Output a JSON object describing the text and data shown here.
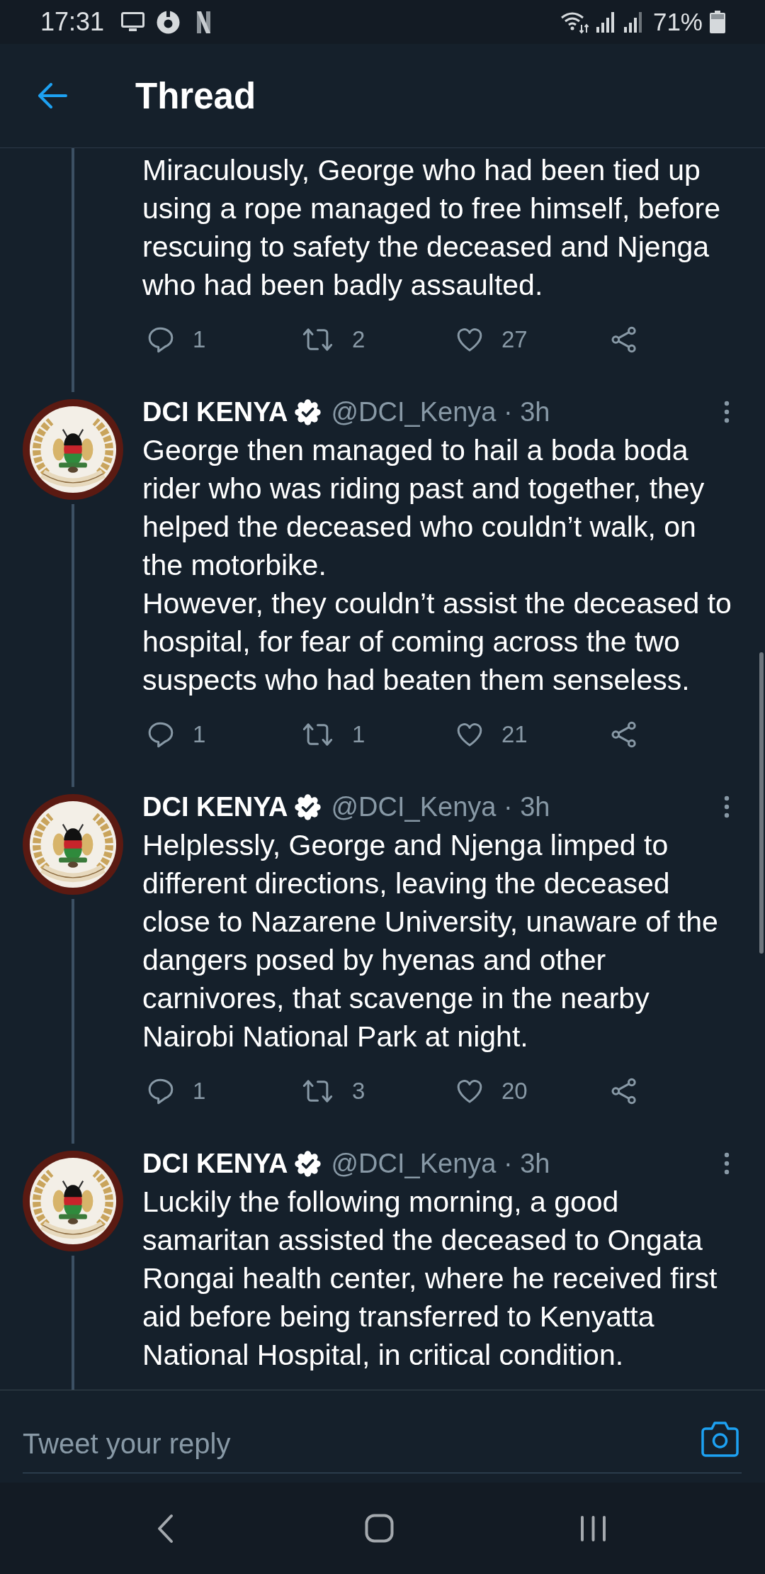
{
  "status_bar": {
    "time": "17:31",
    "battery": "71%"
  },
  "header": {
    "title": "Thread"
  },
  "tweets": [
    {
      "paragraphs": [
        "Miraculously, George who had been tied up using a rope managed to free himself, before rescuing to safety the deceased and Njenga who had been badly assaulted."
      ],
      "actions": [
        {
          "kind": "reply",
          "count": "1"
        },
        {
          "kind": "retweet",
          "count": "2"
        },
        {
          "kind": "like",
          "count": "27"
        },
        {
          "kind": "share"
        }
      ]
    },
    {
      "author": {
        "name": "DCI KENYA",
        "verified": true,
        "byline": "@DCI_Kenya · 3h"
      },
      "paragraphs": [
        "George then managed to hail a boda boda rider who was riding past and together, they helped the deceased who couldn’t walk, on the motorbike.",
        "However, they couldn’t assist the deceased to hospital, for fear of coming across the two suspects who had beaten them senseless."
      ],
      "actions": [
        {
          "kind": "reply",
          "count": "1"
        },
        {
          "kind": "retweet",
          "count": "1"
        },
        {
          "kind": "like",
          "count": "21"
        },
        {
          "kind": "share"
        }
      ]
    },
    {
      "author": {
        "name": "DCI KENYA",
        "verified": true,
        "byline": "@DCI_Kenya · 3h"
      },
      "paragraphs": [
        "Helplessly, George and Njenga limped to different directions, leaving the deceased close to Nazarene University, unaware of the dangers posed by hyenas and other carnivores, that scavenge in the nearby Nairobi National Park at night."
      ],
      "actions": [
        {
          "kind": "reply",
          "count": "1"
        },
        {
          "kind": "retweet",
          "count": "3"
        },
        {
          "kind": "like",
          "count": "20"
        },
        {
          "kind": "share"
        }
      ]
    },
    {
      "author": {
        "name": "DCI KENYA",
        "verified": true,
        "byline": "@DCI_Kenya · 3h"
      },
      "paragraphs": [
        "Luckily the following morning, a good samaritan assisted the deceased to Ongata Rongai health center, where he received first aid before being transferred to Kenyatta National Hospital, in critical condition."
      ]
    }
  ],
  "reply": {
    "placeholder": "Tweet your reply"
  }
}
